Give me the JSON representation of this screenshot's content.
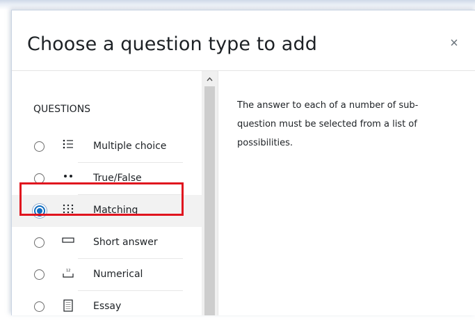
{
  "dialog": {
    "title": "Choose a question type to add",
    "close_symbol": "×"
  },
  "questions": {
    "section_title": "QUESTIONS",
    "items": [
      {
        "label": "Multiple choice",
        "icon": "list-icon",
        "glyph": "⋮☰",
        "selected": false
      },
      {
        "label": "True/False",
        "icon": "two-dots-icon",
        "glyph": "••",
        "selected": false
      },
      {
        "label": "Matching",
        "icon": "matching-grid-icon",
        "glyph": "⁝⁝⁝",
        "selected": true
      },
      {
        "label": "Short answer",
        "icon": "input-box-icon",
        "glyph": "▭",
        "selected": false
      },
      {
        "label": "Numerical",
        "icon": "numerical-icon",
        "glyph": "⊥",
        "selected": false
      },
      {
        "label": "Essay",
        "icon": "essay-document-icon",
        "glyph": "▯",
        "selected": false
      }
    ]
  },
  "scrollbar": {
    "up_arrow": "⌃"
  },
  "description": "The answer to each of a number of sub-question must be selected from a list of possibilities.",
  "colors": {
    "accent": "#0f6cbf",
    "highlight": "#e0141e"
  }
}
